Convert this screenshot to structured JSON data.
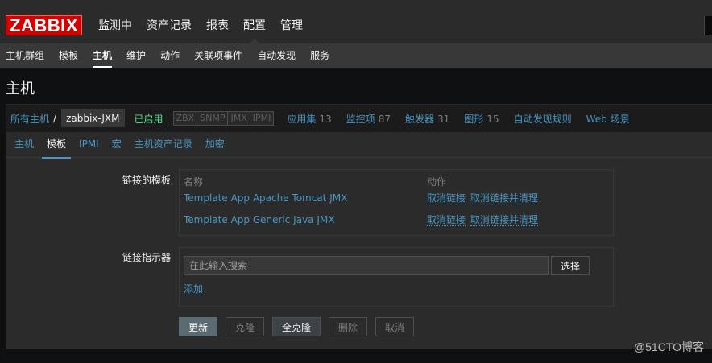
{
  "logo": "ZABBIX",
  "top_nav": [
    "监测中",
    "资产记录",
    "报表",
    "配置",
    "管理"
  ],
  "sub_nav": [
    "主机群组",
    "模板",
    "主机",
    "维护",
    "动作",
    "关联项事件",
    "自动发现",
    "服务"
  ],
  "page_title": "主机",
  "host_bar": {
    "all_hosts": "所有主机",
    "separator": "/",
    "current_host": "zabbix-JXM",
    "status": "已启用",
    "availability": [
      "ZBX",
      "SNMP",
      "JMX",
      "IPMI"
    ],
    "stats": [
      {
        "label": "应用集",
        "count": "13"
      },
      {
        "label": "监控项",
        "count": "87"
      },
      {
        "label": "触发器",
        "count": "31"
      },
      {
        "label": "图形",
        "count": "15"
      }
    ],
    "discovery_rules": "自动发现规则",
    "web_scenarios": "Web 场景"
  },
  "tabs": [
    "主机",
    "模板",
    "IPMI",
    "宏",
    "主机资产记录",
    "加密"
  ],
  "linked_templates": {
    "label": "链接的模板",
    "col_name": "名称",
    "col_action": "动作",
    "rows": [
      {
        "name": "Template App Apache Tomcat JMX",
        "unlink": "取消链接",
        "unlink_clear": "取消链接并清理"
      },
      {
        "name": "Template App Generic Java JMX",
        "unlink": "取消链接",
        "unlink_clear": "取消链接并清理"
      }
    ]
  },
  "link_new": {
    "label": "链接指示器",
    "placeholder": "在此输入搜索",
    "select_label": "选择",
    "add_label": "添加"
  },
  "buttons": {
    "update": "更新",
    "clone": "克隆",
    "full_clone": "全克隆",
    "delete": "删除",
    "cancel": "取消"
  },
  "watermark": "@51CTO博客",
  "colors": {
    "logo_red": "#d40000",
    "link_blue": "#4796c4",
    "enabled_green": "#59db8f",
    "background": "#0e1012"
  }
}
